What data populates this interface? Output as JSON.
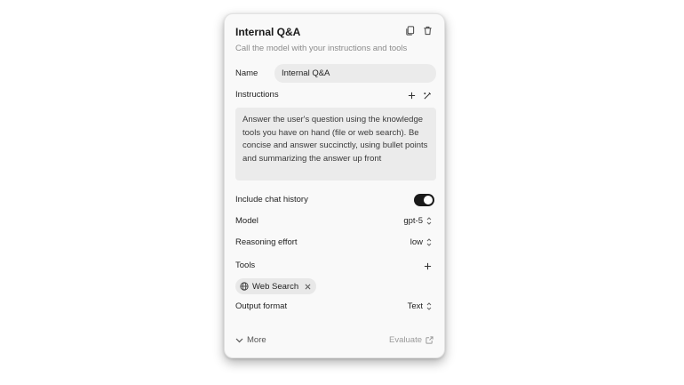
{
  "node": {
    "title": "Internal Q&A",
    "subtitle": "Call the model with your instructions and tools",
    "copy_icon": "copy-icon",
    "delete_icon": "trash-icon"
  },
  "name": {
    "label": "Name",
    "value": "Internal Q&A"
  },
  "instructions": {
    "label": "Instructions",
    "text": "Answer the user's question using the knowledge tools you have on hand (file or web search). Be concise and answer succinctly, using bullet points and summarizing the answer up front"
  },
  "chat_history": {
    "label": "Include chat history",
    "enabled": true
  },
  "model": {
    "label": "Model",
    "value": "gpt-5"
  },
  "reasoning": {
    "label": "Reasoning effort",
    "value": "low"
  },
  "tools": {
    "label": "Tools",
    "items": [
      {
        "label": "Web Search",
        "icon": "globe-icon"
      }
    ]
  },
  "output_format": {
    "label": "Output format",
    "value": "Text"
  },
  "footer": {
    "more": "More",
    "evaluate": "Evaluate"
  },
  "colors": {
    "toggle_on": "#1a1a1a",
    "muted_text": "#8b8b8b",
    "input_bg": "#ebebeb"
  }
}
